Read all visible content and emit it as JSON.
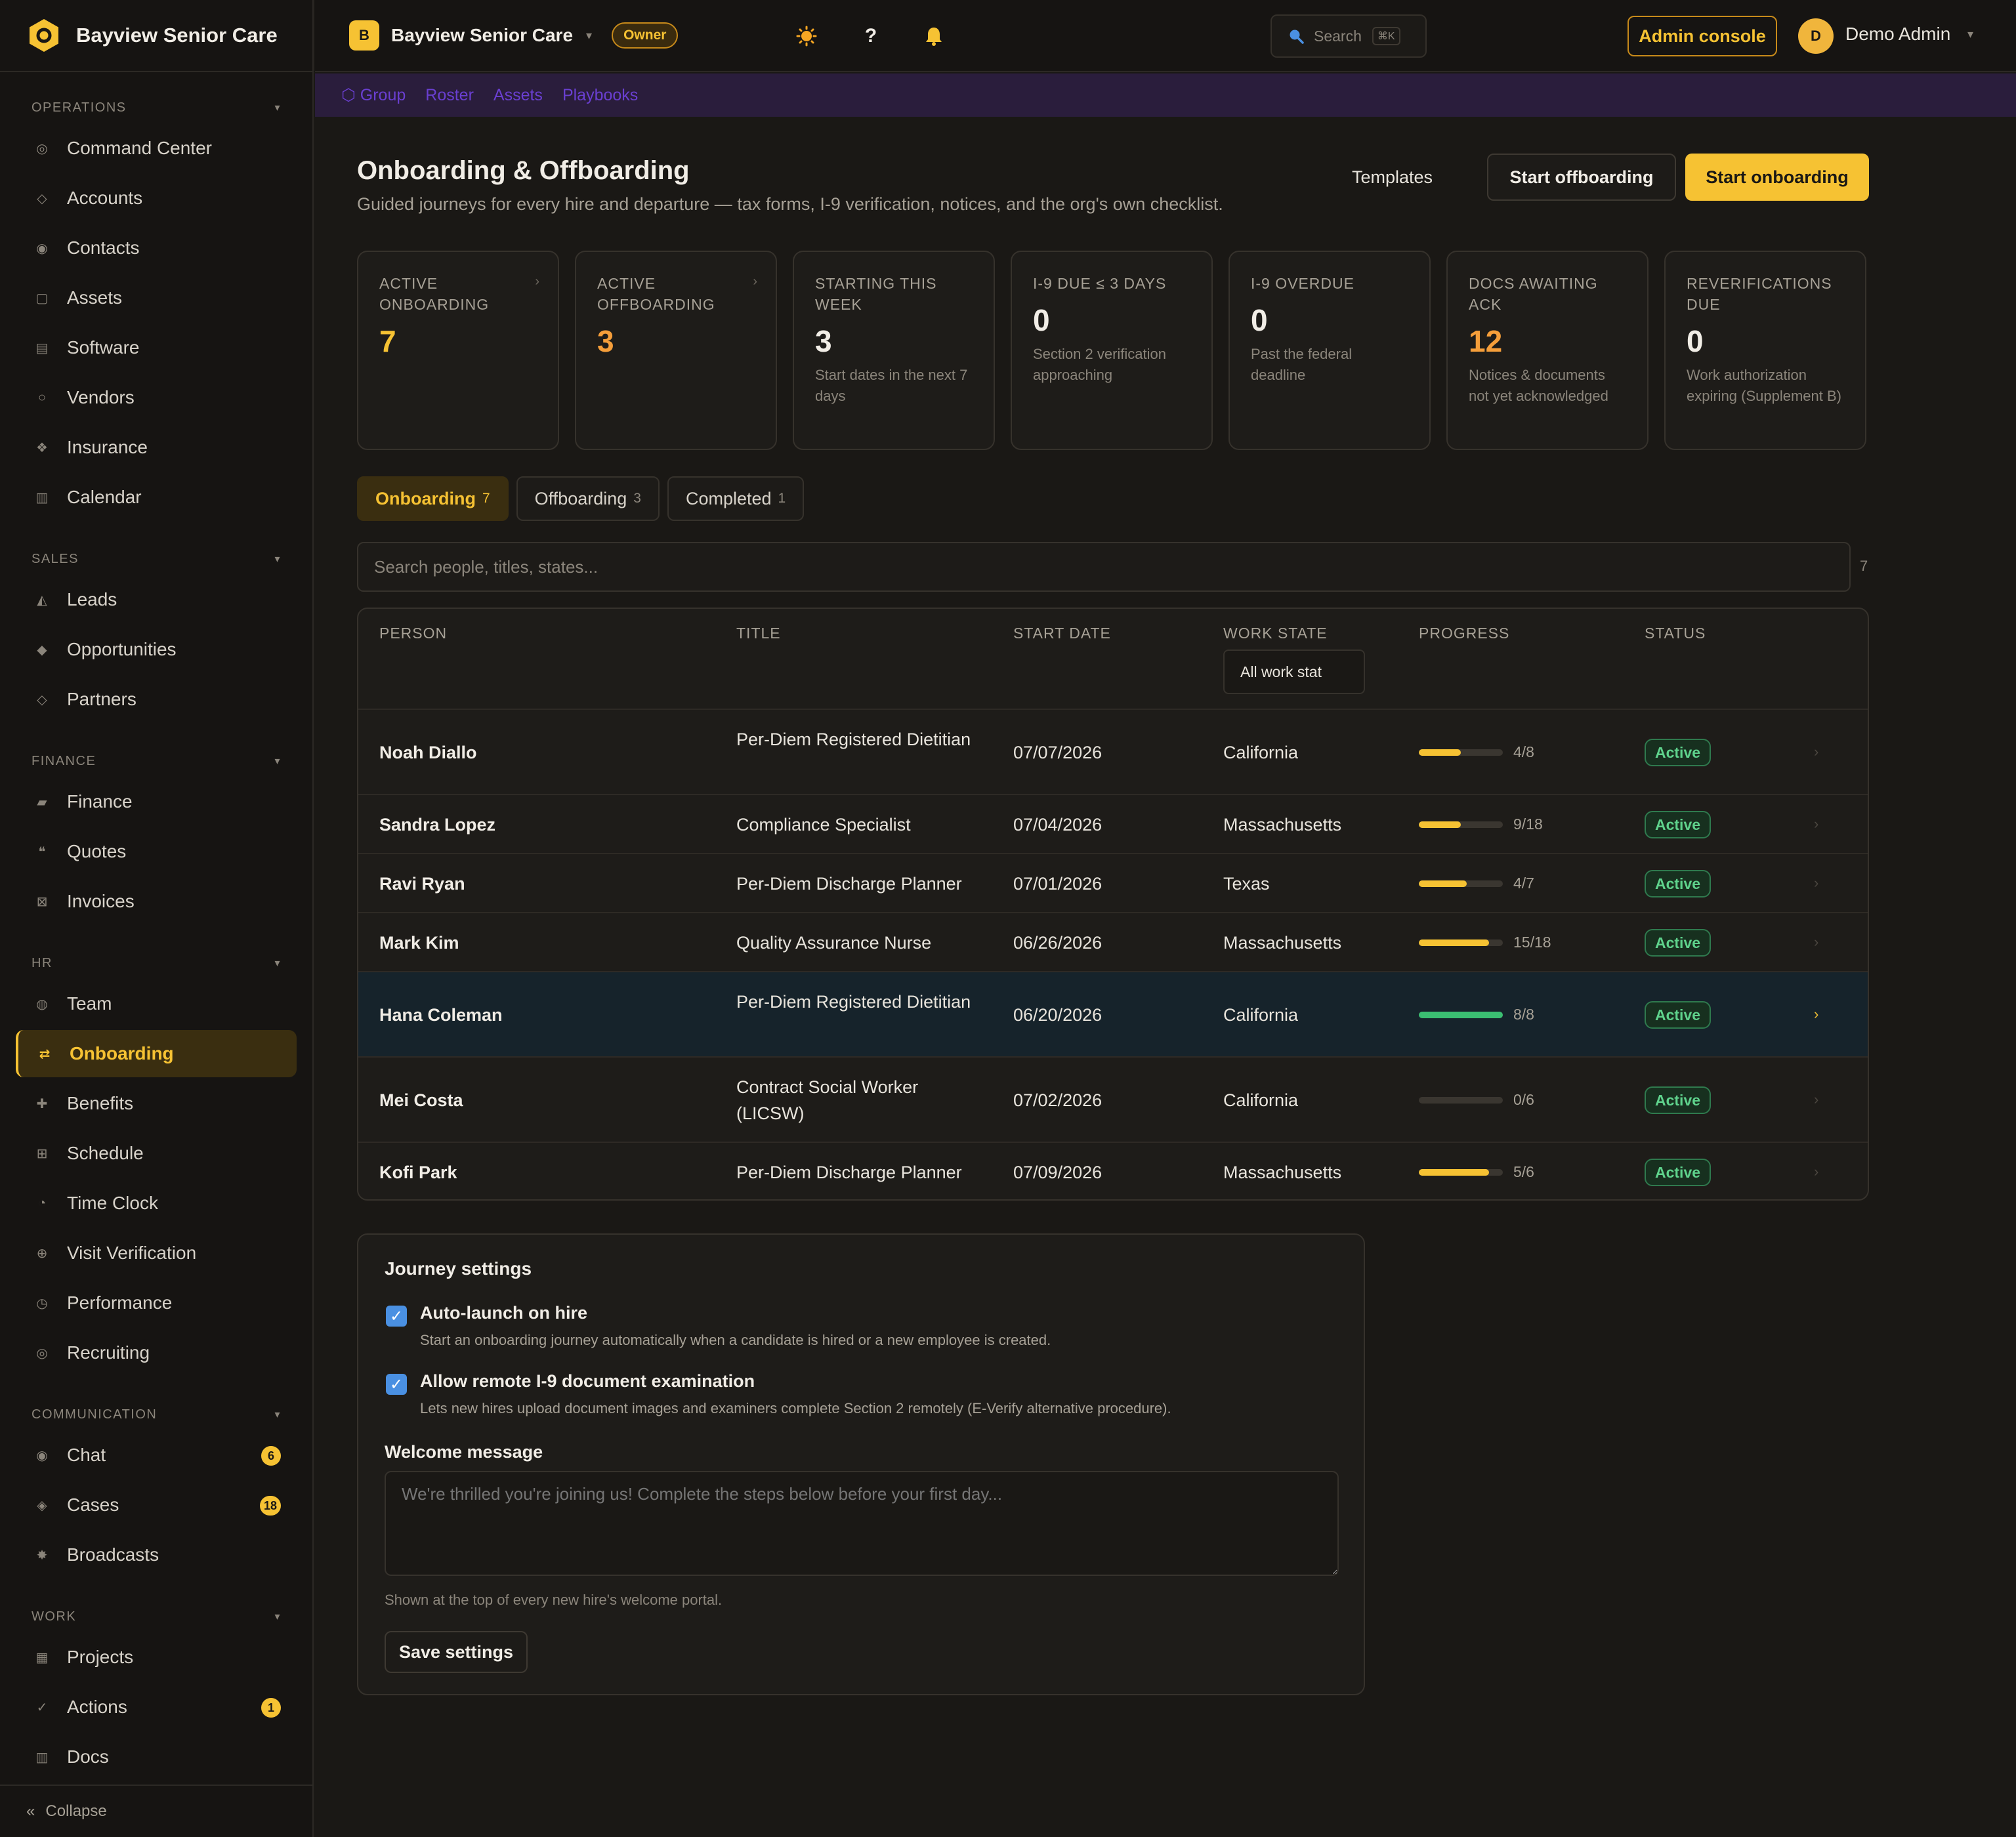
{
  "app": {
    "brand_name": "Bayview Senior Care",
    "logo_icon": "hexagon-logo-icon",
    "accent_color": "#f6c233"
  },
  "sidebar": {
    "sections": [
      {
        "label": "OPERATIONS",
        "items": [
          {
            "label": "Command Center",
            "icon": "◎"
          },
          {
            "label": "Accounts",
            "icon": "◇"
          },
          {
            "label": "Contacts",
            "icon": "◉"
          },
          {
            "label": "Assets",
            "icon": "▢"
          },
          {
            "label": "Software",
            "icon": "▤"
          },
          {
            "label": "Vendors",
            "icon": "○"
          },
          {
            "label": "Insurance",
            "icon": "❖"
          },
          {
            "label": "Calendar",
            "icon": "▥"
          }
        ]
      },
      {
        "label": "SALES",
        "items": [
          {
            "label": "Leads",
            "icon": "◭"
          },
          {
            "label": "Opportunities",
            "icon": "◆"
          },
          {
            "label": "Partners",
            "icon": "◇"
          }
        ]
      },
      {
        "label": "FINANCE",
        "items": [
          {
            "label": "Finance",
            "icon": "▰"
          },
          {
            "label": "Quotes",
            "icon": "❝"
          },
          {
            "label": "Invoices",
            "icon": "⊠"
          }
        ]
      },
      {
        "label": "HR",
        "items": [
          {
            "label": "Team",
            "icon": "◍"
          },
          {
            "label": "Onboarding",
            "icon": "⇄"
          },
          {
            "label": "Benefits",
            "icon": "✚"
          },
          {
            "label": "Schedule",
            "icon": "⊞"
          },
          {
            "label": "Time Clock",
            "icon": "◔"
          },
          {
            "label": "Visit Verification",
            "icon": "⊕"
          },
          {
            "label": "Performance",
            "icon": "◷"
          },
          {
            "label": "Recruiting",
            "icon": "◎"
          }
        ]
      },
      {
        "label": "COMMUNICATION",
        "items": [
          {
            "label": "Chat",
            "icon": "◉",
            "badge": "6"
          },
          {
            "label": "Cases",
            "icon": "◈",
            "badge": "18"
          },
          {
            "label": "Broadcasts",
            "icon": "✸"
          }
        ]
      },
      {
        "label": "WORK",
        "items": [
          {
            "label": "Projects",
            "icon": "▦"
          },
          {
            "label": "Actions",
            "icon": "✓",
            "badge": "1"
          },
          {
            "label": "Docs",
            "icon": "▥"
          }
        ]
      }
    ],
    "active_item": "Onboarding",
    "collapse_label": "Collapse",
    "collapse_icon": "«"
  },
  "topbar": {
    "org_initial": "B",
    "org_name": "Bayview Senior Care",
    "role": "Owner",
    "search_label": "Search",
    "search_shortcut": "⌘K",
    "theme_icon": "sun-icon",
    "help_icon": "question-icon",
    "notifications_icon": "bell-icon",
    "admin_console": "Admin console",
    "user_initial": "D",
    "user_name": "Demo Admin"
  },
  "subnav": {
    "items": [
      "⬡ Group",
      "Roster",
      "Assets",
      "Playbooks"
    ]
  },
  "page": {
    "title": "Onboarding & Offboarding",
    "subtitle": "Guided journeys for every hire and departure — tax forms, I-9 verification, notices, and the org's own checklist.",
    "templates_label": "Templates",
    "start_offboarding": "Start offboarding",
    "start_onboarding": "Start onboarding"
  },
  "kpis": [
    {
      "label": "ACTIVE ONBOARDING",
      "value": "7",
      "desc": "",
      "tone": "gold",
      "arrow": true
    },
    {
      "label": "ACTIVE OFFBOARDING",
      "value": "3",
      "desc": "",
      "tone": "orange",
      "arrow": true
    },
    {
      "label": "STARTING THIS WEEK",
      "value": "3",
      "desc": "Start dates in the next 7 days",
      "tone": "",
      "arrow": false
    },
    {
      "label": "I-9 DUE ≤ 3 DAYS",
      "value": "0",
      "desc": "Section 2 verification approaching",
      "tone": "",
      "arrow": false
    },
    {
      "label": "I-9 OVERDUE",
      "value": "0",
      "desc": "Past the federal deadline",
      "tone": "",
      "arrow": false
    },
    {
      "label": "DOCS AWAITING ACK",
      "value": "12",
      "desc": "Notices & documents not yet acknowledged",
      "tone": "orange",
      "arrow": false
    },
    {
      "label": "REVERIFICATIONS DUE",
      "value": "0",
      "desc": "Work authorization expiring (Supplement B)",
      "tone": "",
      "arrow": false
    }
  ],
  "tabs": [
    {
      "label": "Onboarding",
      "count": "7",
      "active": true
    },
    {
      "label": "Offboarding",
      "count": "3",
      "active": false
    },
    {
      "label": "Completed",
      "count": "1",
      "active": false
    }
  ],
  "search": {
    "placeholder": "Search people, titles, states...",
    "count": "7"
  },
  "table": {
    "headers": {
      "person": "PERSON",
      "title": "TITLE",
      "start_date": "START DATE",
      "work_state": "WORK STATE",
      "progress": "PROGRESS",
      "status": "STATUS"
    },
    "work_state_filter": "All work stat",
    "rows": [
      {
        "person": "Noah Diallo",
        "title": "Per-Diem Registered Dietitian",
        "start_date": "07/07/2026",
        "state": "California",
        "done": 4,
        "total": 8,
        "progress": "4/8",
        "status": "Active",
        "highlight": false
      },
      {
        "person": "Sandra Lopez",
        "title": "Compliance Specialist",
        "start_date": "07/04/2026",
        "state": "Massachusetts",
        "done": 9,
        "total": 18,
        "progress": "9/18",
        "status": "Active",
        "highlight": false
      },
      {
        "person": "Ravi Ryan",
        "title": "Per-Diem Discharge Planner",
        "start_date": "07/01/2026",
        "state": "Texas",
        "done": 4,
        "total": 7,
        "progress": "4/7",
        "status": "Active",
        "highlight": false
      },
      {
        "person": "Mark Kim",
        "title": "Quality Assurance Nurse",
        "start_date": "06/26/2026",
        "state": "Massachusetts",
        "done": 15,
        "total": 18,
        "progress": "15/18",
        "status": "Active",
        "highlight": false
      },
      {
        "person": "Hana Coleman",
        "title": "Per-Diem Registered Dietitian",
        "start_date": "06/20/2026",
        "state": "California",
        "done": 8,
        "total": 8,
        "progress": "8/8",
        "status": "Active",
        "highlight": true
      },
      {
        "person": "Mei Costa",
        "title": "Contract Social Worker (LICSW)",
        "start_date": "07/02/2026",
        "state": "California",
        "done": 0,
        "total": 6,
        "progress": "0/6",
        "status": "Active",
        "highlight": false
      },
      {
        "person": "Kofi Park",
        "title": "Per-Diem Discharge Planner",
        "start_date": "07/09/2026",
        "state": "Massachusetts",
        "done": 5,
        "total": 6,
        "progress": "5/6",
        "status": "Active",
        "highlight": false
      }
    ]
  },
  "settings": {
    "title": "Journey settings",
    "auto_launch_label": "Auto-launch on hire",
    "auto_launch_desc": "Start an onboarding journey automatically when a candidate is hired or a new employee is created.",
    "auto_launch_checked": true,
    "remote_i9_label": "Allow remote I-9 document examination",
    "remote_i9_desc": "Lets new hires upload document images and examiners complete Section 2 remotely (E-Verify alternative procedure).",
    "remote_i9_checked": true,
    "welcome_label": "Welcome message",
    "welcome_placeholder": "We're thrilled you're joining us! Complete the steps below before your first day...",
    "welcome_help": "Shown at the top of every new hire's welcome portal.",
    "save_label": "Save settings"
  }
}
